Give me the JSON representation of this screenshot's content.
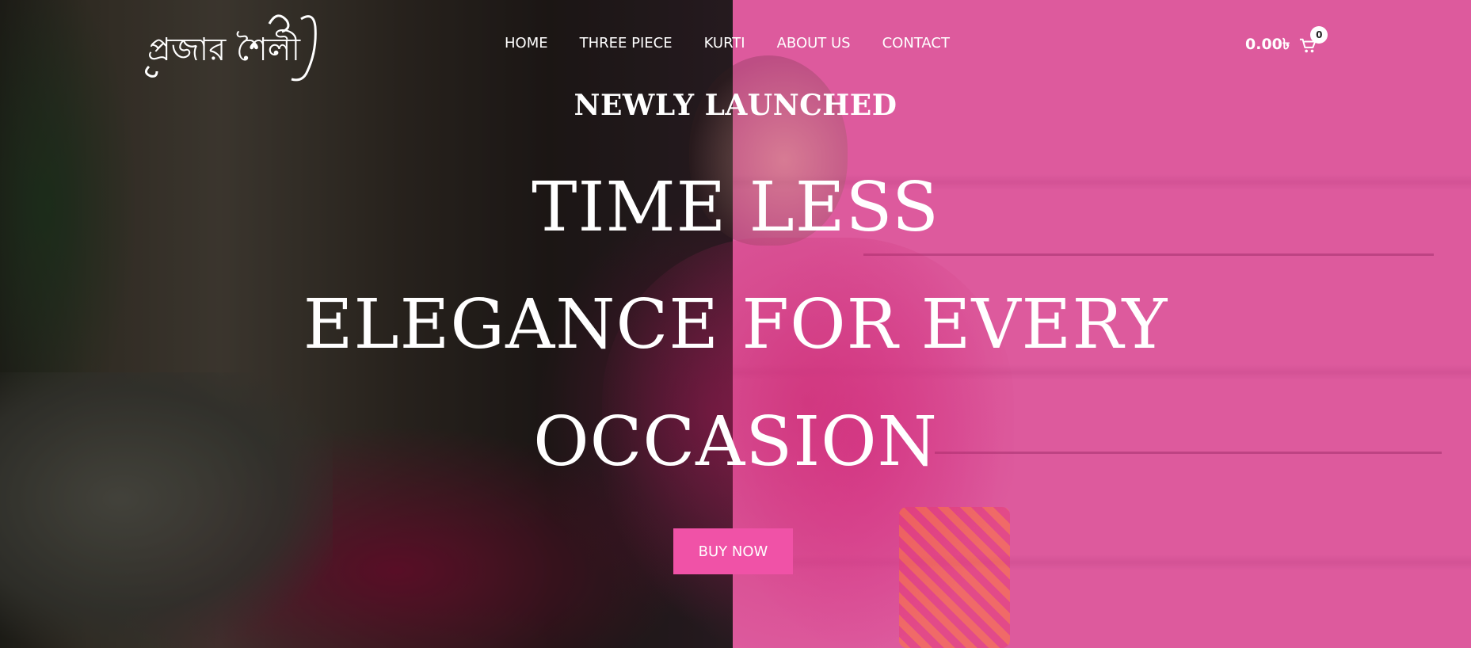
{
  "brand": {
    "logo_text": "প্রজার শৈলী"
  },
  "nav": {
    "items": [
      "HOME",
      "THREE PIECE",
      "KURTI",
      "ABOUT US",
      "CONTACT"
    ]
  },
  "cart": {
    "total": "0.00৳",
    "count": "0",
    "icon": "cart-icon"
  },
  "hero": {
    "eyebrow": "NEWLY LAUNCHED",
    "headline_lines": [
      "TIME LESS",
      "ELEGANCE FOR EVERY",
      "OCCASION"
    ],
    "cta_label": "BUY NOW"
  },
  "colors": {
    "accent": "#f052a7",
    "right_overlay": "#e85aa0",
    "text": "#ffffff"
  }
}
